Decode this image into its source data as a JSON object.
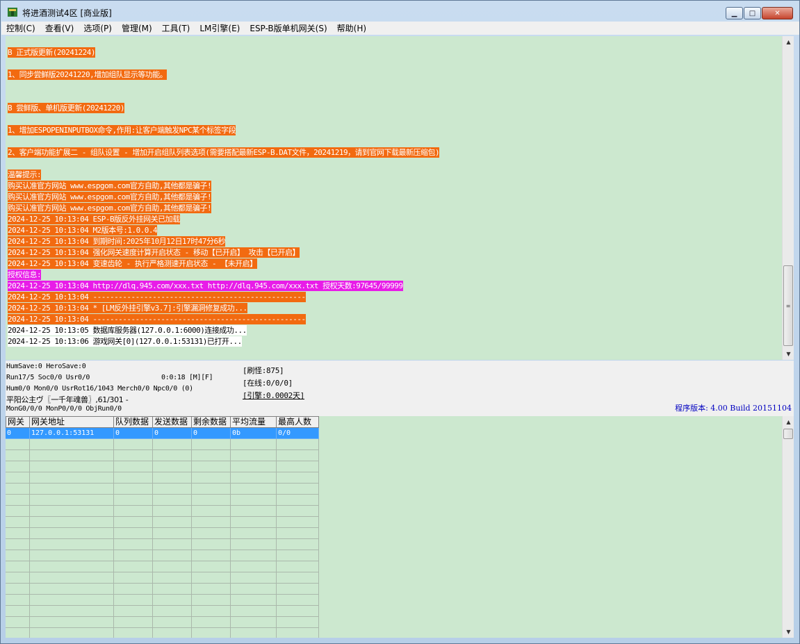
{
  "window": {
    "title": "将进酒测试4区 [商业版]"
  },
  "window_buttons": {
    "minimize": "▁",
    "maximize": "□",
    "close": "✕"
  },
  "menu": [
    "控制(C)",
    "查看(V)",
    "选项(P)",
    "管理(M)",
    "工具(T)",
    "LM引擎(E)",
    "ESP-B版单机网关(S)",
    "帮助(H)"
  ],
  "log": [
    {
      "text": "B 正式版更新(20241224)",
      "style": "orange"
    },
    {
      "text": "1、同步尝鲜版20241220,增加组队显示等功能。",
      "style": "orange"
    },
    {
      "text": "B 尝鲜版、单机版更新(20241220)",
      "style": "orange"
    },
    {
      "text": "1、增加ESPOPENINPUTBOX命令,作用:让客户端触发NPC某个标签字段",
      "style": "orange"
    },
    {
      "text": "2、客户端功能扩展二 - 组队设置 - 增加开启组队列表选项(需要搭配最新ESP-B.DAT文件，20241219，请到官网下载最新压缩包)",
      "style": "orange"
    },
    {
      "text": "温馨提示:",
      "style": "orange"
    },
    {
      "text": "购买认准官方网站 www.espgom.com官方自助,其他都是骗子!",
      "style": "orange"
    },
    {
      "text": "购买认准官方网站 www.espgom.com官方自助,其他都是骗子!",
      "style": "orange"
    },
    {
      "text": "购买认准官方网站 www.espgom.com官方自助,其他都是骗子!",
      "style": "orange"
    },
    {
      "text": "2024-12-25 10:13:04 ESP-B版反外挂网关已加载",
      "style": "orange"
    },
    {
      "text": "2024-12-25 10:13:04 M2版本号:1.0.0.4",
      "style": "orange"
    },
    {
      "text": "2024-12-25 10:13:04 到期时间:2025年10月12日17时47分6秒",
      "style": "orange"
    },
    {
      "text": "2024-12-25 10:13:04 强化网关速度计算开启状态 - 移动【已开启】 攻击【已开启】",
      "style": "orange"
    },
    {
      "text": "2024-12-25 10:13:04 变速齿轮 - 执行严格测速开启状态 - 【未开启】",
      "style": "orange"
    },
    {
      "text": "授权信息:",
      "style": "magenta"
    },
    {
      "text": "2024-12-25 10:13:04 http://dlq.945.com/xxx.txt http://dlq.945.com/xxx.txt 授权天数:97645/99999",
      "style": "magenta"
    },
    {
      "text": "2024-12-25 10:13:04 --------------------------------------------------",
      "style": "orange"
    },
    {
      "text": "2024-12-25 10:13:04 * [LM反外挂引擎v3.7]:引擎漏洞修复成功...",
      "style": "orange"
    },
    {
      "text": "2024-12-25 10:13:04 --------------------------------------------------",
      "style": "orange"
    },
    {
      "text": "2024-12-25 10:13:05 数据库服务器(127.0.0.1:6000)连接成功...",
      "style": "white"
    },
    {
      "text": "2024-12-25 10:13:06 游戏网关[0](127.0.0.1:53131)已打开...",
      "style": "white"
    }
  ],
  "status": {
    "line1": "HumSave:0 HeroSave:0",
    "line2": "Run17/5 Soc0/0 Usr0/0",
    "timer": "0:0:18 [M][F]",
    "line3": "Hum0/0 Mon0/0 UsrRot16/1043 Merch0/0 Npc0/0 (0)",
    "line4": "平阳公主ヴ〖一千年魂兽〗,61/301 -",
    "line5": "MonG0/0/0 MonP0/0/0 ObjRun0/0",
    "refresh": "[刷怪:875]",
    "online": "[在线:0/0/0]",
    "engine": "[引擎:0.0002天]",
    "version": "程序版本: 4.00 Build 20151104"
  },
  "gateway_table": {
    "columns": [
      "网关",
      "网关地址",
      "队列数据",
      "发送数据",
      "剩余数据",
      "平均流量",
      "最高人数"
    ],
    "rows": [
      [
        "0",
        "127.0.0.1:53131",
        "0",
        "0",
        "0",
        "0b",
        "0/0"
      ]
    ]
  },
  "scrollbar_arrows": {
    "up": "▲",
    "down": "▼",
    "grip": "≡"
  },
  "colors": {
    "log_bg": "#cce8cf",
    "highlight_orange": "#f26a10",
    "highlight_magenta": "#e81ce8",
    "selected_row": "#3399ff",
    "version_text": "#0000c0"
  }
}
